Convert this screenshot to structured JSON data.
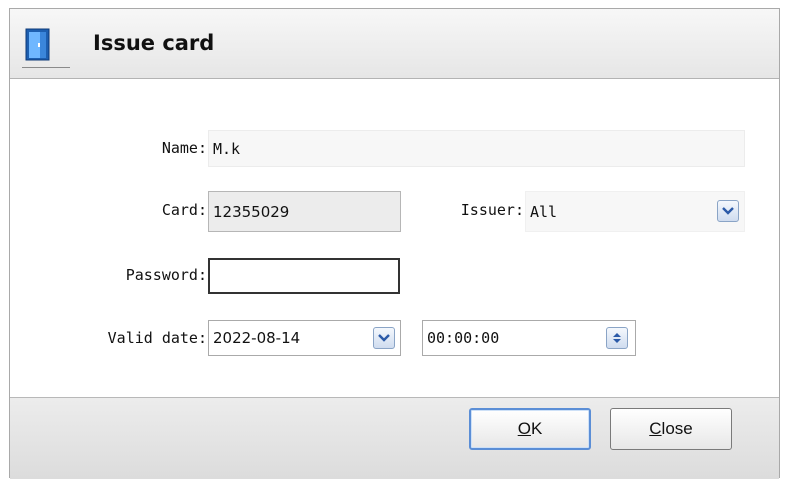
{
  "dialog": {
    "title": "Issue card",
    "icon": "door-icon"
  },
  "form": {
    "name_label": "Name:",
    "name_value": "M.k",
    "card_label": "Card:",
    "card_value": "12355029",
    "issuer_label": "Issuer:",
    "issuer_value": "All",
    "password_label": "Password:",
    "password_value": "",
    "valid_date_label": "Valid date:",
    "valid_date_value": "2022-08-14",
    "valid_time_value": "00:00:00"
  },
  "buttons": {
    "ok_mnemonic": "O",
    "ok_rest": "K",
    "close_mnemonic": "C",
    "close_rest": "lose"
  },
  "colors": {
    "accent": "#5b8ed6",
    "title_bar": "#e6e6e6",
    "readonly_field": "#ececec"
  }
}
